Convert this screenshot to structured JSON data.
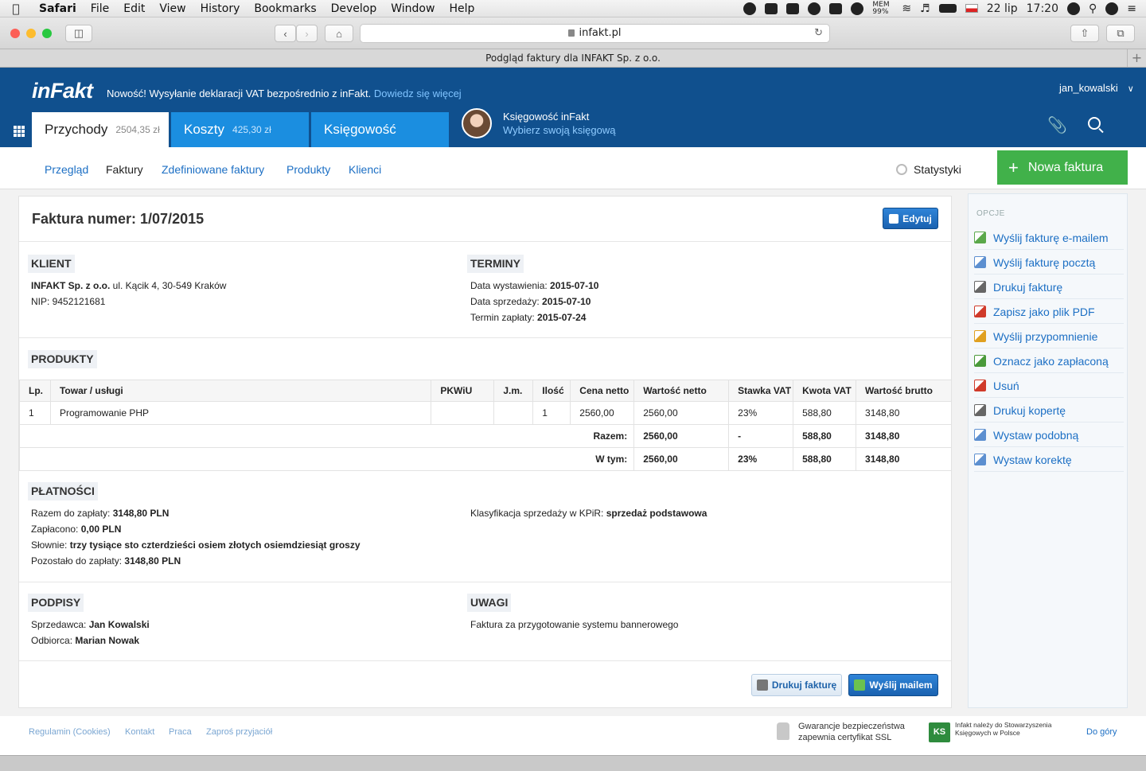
{
  "menubar": {
    "app": "Safari",
    "items": [
      "File",
      "Edit",
      "View",
      "History",
      "Bookmarks",
      "Develop",
      "Window",
      "Help"
    ],
    "mem": "MEM 99%",
    "date": "22 lip",
    "time": "17:20"
  },
  "browser": {
    "url": "infakt.pl",
    "tab_title": "Podgląd faktury dla INFAKT Sp. z o.o."
  },
  "header": {
    "logo": "inFakt",
    "news_text": "Nowość! Wysyłanie deklaracji VAT bezpośrednio z inFakt.",
    "news_link": "Dowiedz się więcej",
    "username": "jan_kowalski",
    "tabs": [
      {
        "label": "Przychody",
        "amount": "2504,35 zł"
      },
      {
        "label": "Koszty",
        "amount": "425,30 zł"
      },
      {
        "label": "Księgowość",
        "amount": ""
      }
    ],
    "accounting_title": "Księgowość inFakt",
    "accounting_link": "Wybierz swoją księgową"
  },
  "subnav": {
    "items": [
      "Przegląd",
      "Faktury",
      "Zdefiniowane faktury",
      "Produkty",
      "Klienci"
    ],
    "stats": "Statystyki",
    "new_invoice": "Nowa faktura"
  },
  "invoice": {
    "title": "Faktura numer: 1/07/2015",
    "edit": "Edytuj",
    "client_header": "KLIENT",
    "client_name": "INFAKT Sp. z o.o.",
    "client_address": " ul. Kącik 4, 30-549 Kraków",
    "client_nip": "NIP: 9452121681",
    "terms_header": "TERMINY",
    "issue_label": "Data wystawienia: ",
    "issue_date": "2015-07-10",
    "sale_label": "Data sprzedaży: ",
    "sale_date": "2015-07-10",
    "due_label": "Termin zapłaty: ",
    "due_date": "2015-07-24",
    "products_header": "PRODUKTY",
    "columns": [
      "Lp.",
      "Towar / usługi",
      "PKWiU",
      "J.m.",
      "Ilość",
      "Cena netto",
      "Wartość netto",
      "Stawka VAT",
      "Kwota VAT",
      "Wartość brutto"
    ],
    "rows": [
      {
        "lp": "1",
        "name": "Programowanie PHP",
        "pkwiu": "",
        "jm": "",
        "qty": "1",
        "price": "2560,00",
        "net": "2560,00",
        "vat_rate": "23%",
        "vat": "588,80",
        "gross": "3148,80"
      }
    ],
    "total": {
      "label": "Razem:",
      "net": "2560,00",
      "vat_rate": "-",
      "vat": "588,80",
      "gross": "3148,80"
    },
    "incl": {
      "label": "W tym:",
      "net": "2560,00",
      "vat_rate": "23%",
      "vat": "588,80",
      "gross": "3148,80"
    },
    "payments_header": "PŁATNOŚCI",
    "to_pay_label": "Razem do zapłaty: ",
    "to_pay": "3148,80 PLN",
    "paid_label": "Zapłacono: ",
    "paid": "0,00 PLN",
    "words_label": "Słownie: ",
    "words": "trzy tysiące sto czterdzieści osiem złotych osiemdziesiąt groszy",
    "remaining_label": "Pozostało do zapłaty: ",
    "remaining": "3148,80 PLN",
    "classification_label": "Klasyfikacja sprzedaży w KPiR: ",
    "classification": "sprzedaż podstawowa",
    "signatures_header": "PODPISY",
    "seller_label": "Sprzedawca: ",
    "seller": "Jan Kowalski",
    "buyer_label": "Odbiorca: ",
    "buyer": "Marian Nowak",
    "notes_header": "UWAGI",
    "notes": "Faktura za przygotowanie systemu bannerowego",
    "print_btn": "Drukuj fakturę",
    "mail_btn": "Wyślij mailem"
  },
  "sidebar": {
    "title": "OPCJE",
    "options": [
      {
        "label": "Wyślij fakturę e-mailem",
        "color": "#5aa84a"
      },
      {
        "label": "Wyślij fakturę pocztą",
        "color": "#5c8fd0"
      },
      {
        "label": "Drukuj fakturę",
        "color": "#666666"
      },
      {
        "label": "Zapisz jako plik PDF",
        "color": "#d03a2a"
      },
      {
        "label": "Wyślij przypomnienie",
        "color": "#e0a020"
      },
      {
        "label": "Oznacz jako zapłaconą",
        "color": "#4a9a3a"
      },
      {
        "label": "Usuń",
        "color": "#d03a2a"
      },
      {
        "label": "Drukuj kopertę",
        "color": "#666666"
      },
      {
        "label": "Wystaw podobną",
        "color": "#5c8fd0"
      },
      {
        "label": "Wystaw korektę",
        "color": "#5c8fd0"
      }
    ]
  },
  "footer": {
    "links": [
      "Regulamin (Cookies)",
      "Kontakt",
      "Praca",
      "Zaproś przyjaciół"
    ],
    "ssl_line1": "Gwarancje bezpieczeństwa",
    "ssl_line2": "zapewnia certyfikat SSL",
    "ks_logo": "KS",
    "ks_text": "Infakt należy do Stowarzyszenia Księgowych w Polsce",
    "top": "Do góry"
  }
}
